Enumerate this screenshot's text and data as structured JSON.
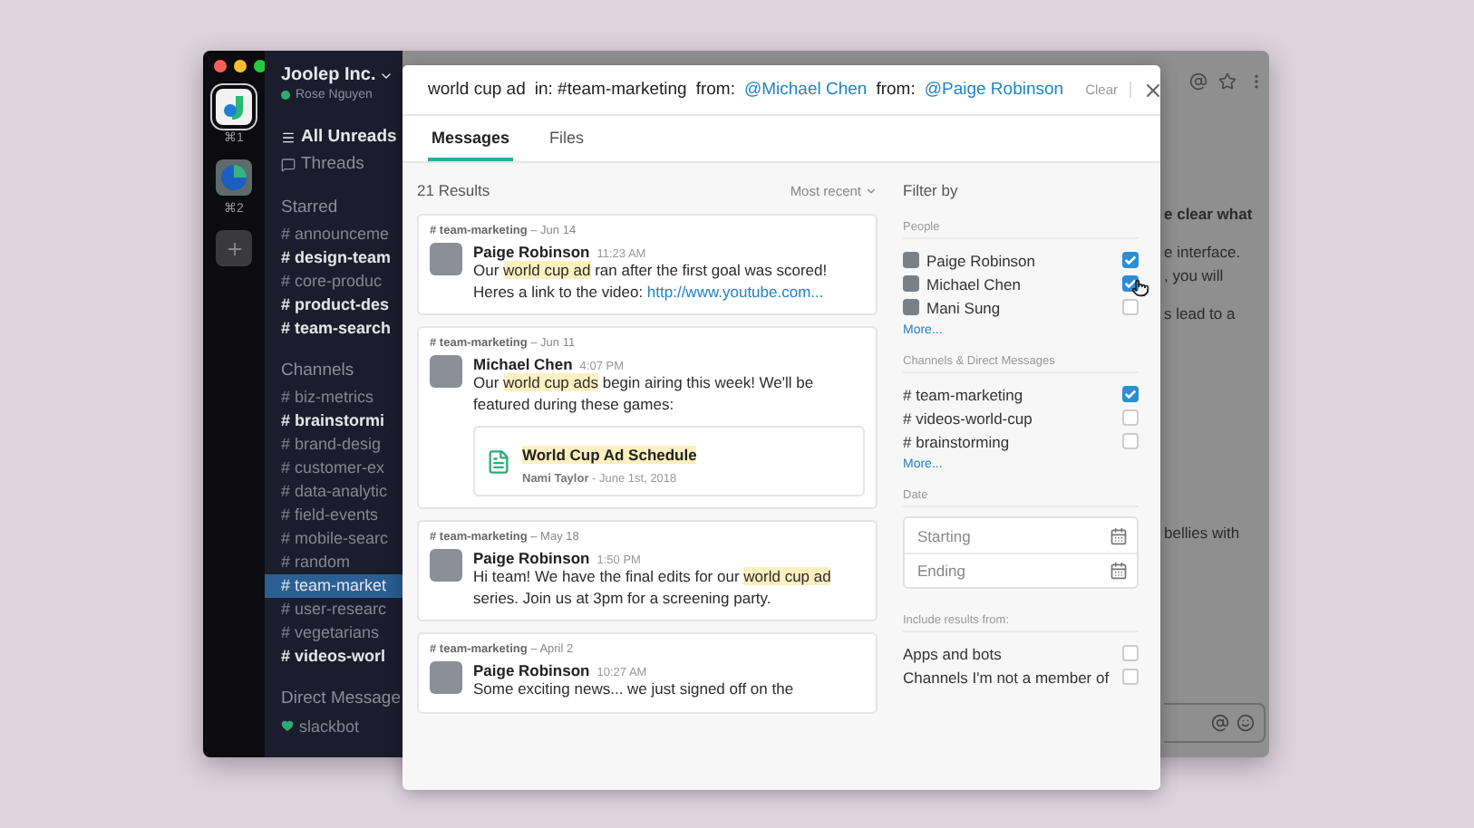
{
  "rail": {
    "workspaces": [
      {
        "shortcut": "⌘1",
        "selected": true,
        "kind": "drop"
      },
      {
        "shortcut": "⌘2",
        "selected": false,
        "kind": "globe"
      }
    ]
  },
  "sidebar": {
    "team": "Joolep Inc.",
    "user": "Rose Nguyen",
    "nav": [
      {
        "label": "All Unreads",
        "kind": "unreads"
      },
      {
        "label": "Threads",
        "kind": "threads"
      }
    ],
    "sections": [
      {
        "title": "Starred",
        "kind": "channels",
        "items": [
          {
            "name": "# announceme",
            "unread": false,
            "selected": false
          },
          {
            "name": "# design-team",
            "unread": true,
            "selected": false
          },
          {
            "name": "# core-produc",
            "unread": false,
            "selected": false
          },
          {
            "name": "# product-des",
            "unread": true,
            "selected": false
          },
          {
            "name": "# team-search",
            "unread": true,
            "selected": false
          }
        ]
      },
      {
        "title": "Channels",
        "kind": "channels",
        "items": [
          {
            "name": "# biz-metrics",
            "unread": false,
            "selected": false
          },
          {
            "name": "# brainstormi",
            "unread": true,
            "selected": false
          },
          {
            "name": "# brand-desig",
            "unread": false,
            "selected": false
          },
          {
            "name": "# customer-ex",
            "unread": false,
            "selected": false
          },
          {
            "name": "# data-analytic",
            "unread": false,
            "selected": false
          },
          {
            "name": "# field-events",
            "unread": false,
            "selected": false
          },
          {
            "name": "# mobile-searc",
            "unread": false,
            "selected": false
          },
          {
            "name": "# random",
            "unread": false,
            "selected": false
          },
          {
            "name": "# team-market",
            "unread": false,
            "selected": true
          },
          {
            "name": "# user-researc",
            "unread": false,
            "selected": false
          },
          {
            "name": "# vegetarians",
            "unread": false,
            "selected": false
          },
          {
            "name": "# videos-worl",
            "unread": true,
            "selected": false
          }
        ]
      },
      {
        "title": "Direct Message",
        "kind": "dms",
        "items": [
          {
            "name": "slackbot"
          }
        ]
      }
    ]
  },
  "main": {
    "paragraphs": [
      {
        "lines": [
          "e clear what"
        ],
        "bold": true
      },
      {
        "lines": [
          "e interface.",
          ", you will"
        ],
        "bold": false
      },
      {
        "lines": [
          "s lead to a"
        ],
        "bold": false
      }
    ],
    "lower": {
      "lines": [
        "bellies with"
      ],
      "bold": false
    }
  },
  "search": {
    "query": [
      {
        "text": "world cup ad",
        "kind": "plain"
      },
      {
        "text": "in: #team-marketing",
        "kind": "plain"
      },
      {
        "text": "from:",
        "kind": "plain"
      },
      {
        "text": "@Michael Chen",
        "kind": "mention"
      },
      {
        "text": "from:",
        "kind": "plain"
      },
      {
        "text": "@Paige Robinson",
        "kind": "mention"
      }
    ],
    "clear": "Clear"
  },
  "tabs": [
    {
      "label": "Messages",
      "selected": true
    },
    {
      "label": "Files",
      "selected": false
    }
  ],
  "results": {
    "count": "21 Results",
    "sort": "Most recent",
    "messages": [
      {
        "header": "**# team-marketing** – Jun 14",
        "author": "Paige Robinson",
        "time": "11:23 AM",
        "text": [
          {
            "text": "Our ",
            "kind": "plain"
          },
          {
            "text": "world cup ad",
            "kind": "highlight"
          },
          {
            "text": " ran after the first goal was scored! Heres a link to the video: ",
            "kind": "plain"
          },
          {
            "text": "http://www.youtube.com...",
            "kind": "link"
          }
        ]
      },
      {
        "header": "**# team-marketing** – Jun 11",
        "author": "Michael Chen",
        "time": "4:07 PM",
        "text": [
          {
            "text": "Our ",
            "kind": "plain"
          },
          {
            "text": "world cup ads",
            "kind": "highlight"
          },
          {
            "text": " begin airing this week! We'll be featured during these games:",
            "kind": "plain"
          }
        ],
        "attachment": {
          "title": "World Cup Ad Schedule",
          "meta": "**Nami Taylor** - June 1st, 2018"
        }
      },
      {
        "header": "**# team-marketing** – May 18",
        "author": "Paige Robinson",
        "time": "1:50 PM",
        "text": [
          {
            "text": "Hi team! We have the final edits for our ",
            "kind": "plain"
          },
          {
            "text": "world cup ad",
            "kind": "highlight"
          },
          {
            "text": " series. Join us at 3pm for a screening party.",
            "kind": "plain"
          }
        ]
      },
      {
        "header": "**# team-marketing** – April 2",
        "author": "Paige Robinson",
        "time": "10:27 AM",
        "text": [
          {
            "text": "Some exciting news... we just signed off on the",
            "kind": "plain"
          }
        ]
      }
    ]
  },
  "filters": {
    "title": "Filter by",
    "groups": [
      {
        "title": "People",
        "kind": "people",
        "more": "More...",
        "items": [
          {
            "name": "Paige Robinson",
            "checked": true
          },
          {
            "name": "Michael Chen",
            "checked": true
          },
          {
            "name": "Mani Sung",
            "checked": false
          }
        ]
      },
      {
        "title": "Channels & Direct Messages",
        "kind": "channels",
        "more": "More...",
        "items": [
          {
            "name": "# team-marketing",
            "checked": true
          },
          {
            "name": "# videos-world-cup",
            "checked": false
          },
          {
            "name": "# brainstorming",
            "checked": false
          }
        ]
      }
    ],
    "date": {
      "title": "Date",
      "fields": [
        {
          "placeholder": "Starting"
        },
        {
          "placeholder": "Ending"
        }
      ]
    },
    "include": {
      "title": "Include results from:",
      "items": [
        {
          "name": "Apps and bots",
          "checked": false
        },
        {
          "name": "Channels I'm not a member of",
          "checked": false
        }
      ]
    }
  }
}
